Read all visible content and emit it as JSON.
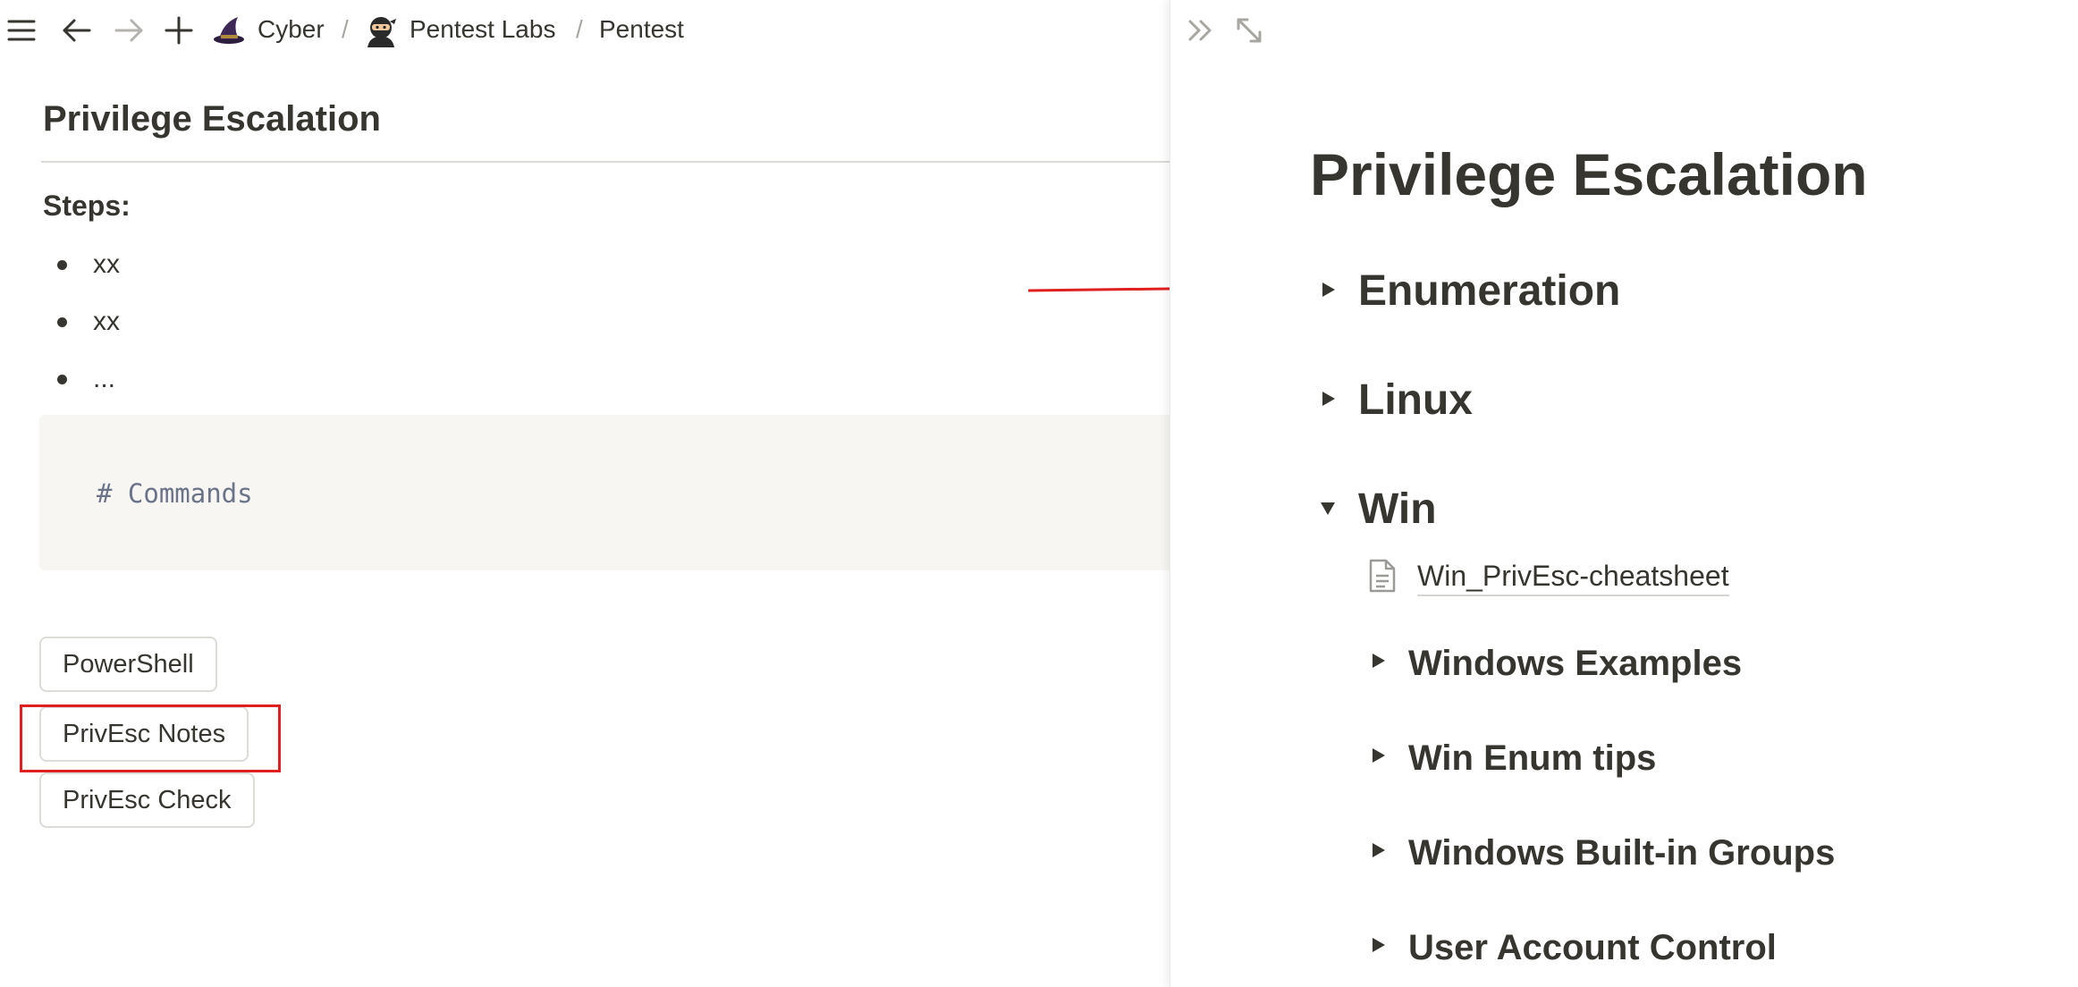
{
  "breadcrumb": {
    "items": [
      {
        "label": "Cyber",
        "icon": "witch-hat-icon"
      },
      {
        "label": "Pentest Labs",
        "icon": "ninja-icon"
      },
      {
        "label": "Pentest"
      }
    ],
    "separator": "/"
  },
  "page": {
    "title": "Privilege Escalation",
    "steps_label": "Steps:",
    "bullets": [
      "xx",
      "xx",
      "..."
    ],
    "code": "# Commands",
    "buttons": [
      "PowerShell",
      "PrivEsc Notes",
      "PrivEsc Check"
    ],
    "highlighted_button": "PrivEsc Notes"
  },
  "peek": {
    "title": "Privilege Escalation",
    "toggles": [
      {
        "label": "Enumeration",
        "state": "collapsed"
      },
      {
        "label": "Linux",
        "state": "collapsed"
      },
      {
        "label": "Win",
        "state": "expanded"
      }
    ],
    "win_children": {
      "doc_link": "Win_PrivEsc-cheatsheet",
      "toggles": [
        {
          "label": "Windows Examples",
          "state": "collapsed"
        },
        {
          "label": "Win Enum tips",
          "state": "collapsed"
        },
        {
          "label": "Windows Built-in Groups",
          "state": "collapsed"
        },
        {
          "label": "User Account Control",
          "state": "collapsed"
        }
      ]
    }
  },
  "colors": {
    "text": "#37352f",
    "annotation_red": "#e02020",
    "code_bg": "#f7f6f3"
  }
}
